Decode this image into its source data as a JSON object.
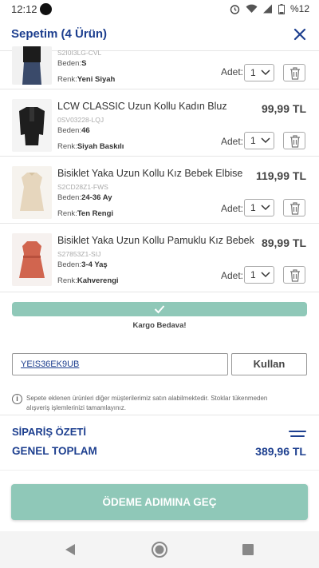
{
  "status_bar": {
    "time": "12:12",
    "battery": "%12"
  },
  "header": {
    "title": "Sepetim (4 Ürün)"
  },
  "items": [
    {
      "name": "",
      "code": "S2I0I3LG-CVL",
      "beden_label": "Beden:",
      "beden": "S",
      "renk_label": "Renk:",
      "renk": "Yeni Siyah",
      "price": "",
      "qty": "1"
    },
    {
      "name": "LCW CLASSIC Uzun Kollu Kadın Bluz",
      "code": "0SV03228-LQJ",
      "beden_label": "Beden:",
      "beden": "46",
      "renk_label": "Renk:",
      "renk": "Siyah Baskılı",
      "price": "99,99 TL",
      "qty": "1"
    },
    {
      "name": "Bisiklet Yaka Uzun Kollu Kız Bebek Elbise",
      "code": "S2CD28Z1-FWS",
      "beden_label": "Beden:",
      "beden": "24-36 Ay",
      "renk_label": "Renk:",
      "renk": "Ten Rengi",
      "price": "119,99 TL",
      "qty": "1"
    },
    {
      "name": "Bisiklet Yaka Uzun Kollu Pamuklu Kız Bebek E...",
      "code": "S27853Z1-SIJ",
      "beden_label": "Beden:",
      "beden": "3-4 Yaş",
      "renk_label": "Renk:",
      "renk": "Kahverengi",
      "price": "89,99 TL",
      "qty": "1"
    }
  ],
  "adet_label": "Adet:",
  "shipping": {
    "text": "Kargo Bedava!"
  },
  "coupon": {
    "value": "YEIS36EK9UB",
    "button": "Kullan"
  },
  "info": {
    "text": "Sepete eklenen ürünleri diğer müşterilerimiz satın alabilmektedir. Stoklar tükenmeden alışveriş işlemlerinizi tamamlayınız."
  },
  "summary": {
    "title": "SİPARİŞ ÖZETİ",
    "total_label": "GENEL TOPLAM",
    "total_value": "389,96 TL"
  },
  "cta": {
    "label": "ÖDEME ADIMINA GEÇ"
  },
  "colors": {
    "brand": "#1d3f8f",
    "accent": "#8fc8b8"
  }
}
